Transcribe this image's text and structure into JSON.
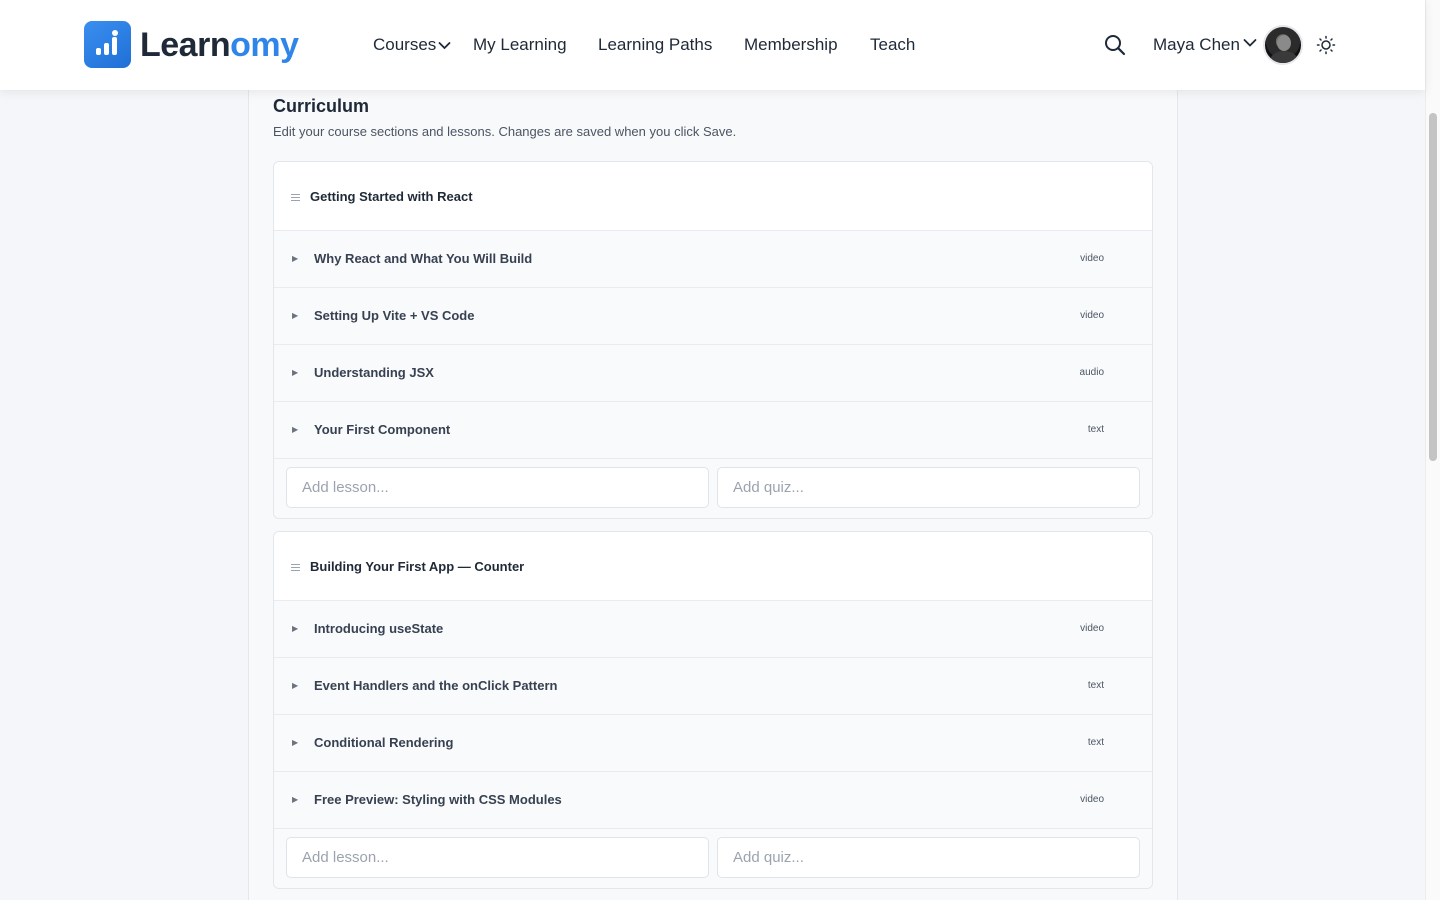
{
  "brand": {
    "name_part1": "Learn",
    "name_part2": "omy",
    "accent": "#2f86e8"
  },
  "nav": {
    "courses": "Courses",
    "my_learning": "My Learning",
    "learning_paths": "Learning Paths",
    "membership": "Membership",
    "teach": "Teach"
  },
  "user": {
    "name": "Maya Chen"
  },
  "icons": {
    "search": "search-icon",
    "theme": "sun-icon",
    "drag": "drag-handle-icon",
    "expand": "caret-right-icon"
  },
  "curriculum": {
    "title": "Curriculum",
    "subtitle": "Edit your course sections and lessons. Changes are saved when you click Save.",
    "sections": [
      {
        "title": "Getting Started with React",
        "lessons": [
          {
            "title": "Why React and What You Will Build",
            "type": "video"
          },
          {
            "title": "Setting Up Vite + VS Code",
            "type": "video"
          },
          {
            "title": "Understanding JSX",
            "type": "audio"
          },
          {
            "title": "Your First Component",
            "type": "text"
          }
        ],
        "add_lesson_placeholder": "Add lesson...",
        "add_quiz_placeholder": "Add quiz..."
      },
      {
        "title": "Building Your First App — Counter",
        "lessons": [
          {
            "title": "Introducing useState",
            "type": "video"
          },
          {
            "title": "Event Handlers and the onClick Pattern",
            "type": "text"
          },
          {
            "title": "Conditional Rendering",
            "type": "text"
          },
          {
            "title": "Free Preview: Styling with CSS Modules",
            "type": "video"
          }
        ],
        "add_lesson_placeholder": "Add lesson...",
        "add_quiz_placeholder": "Add quiz..."
      }
    ]
  }
}
